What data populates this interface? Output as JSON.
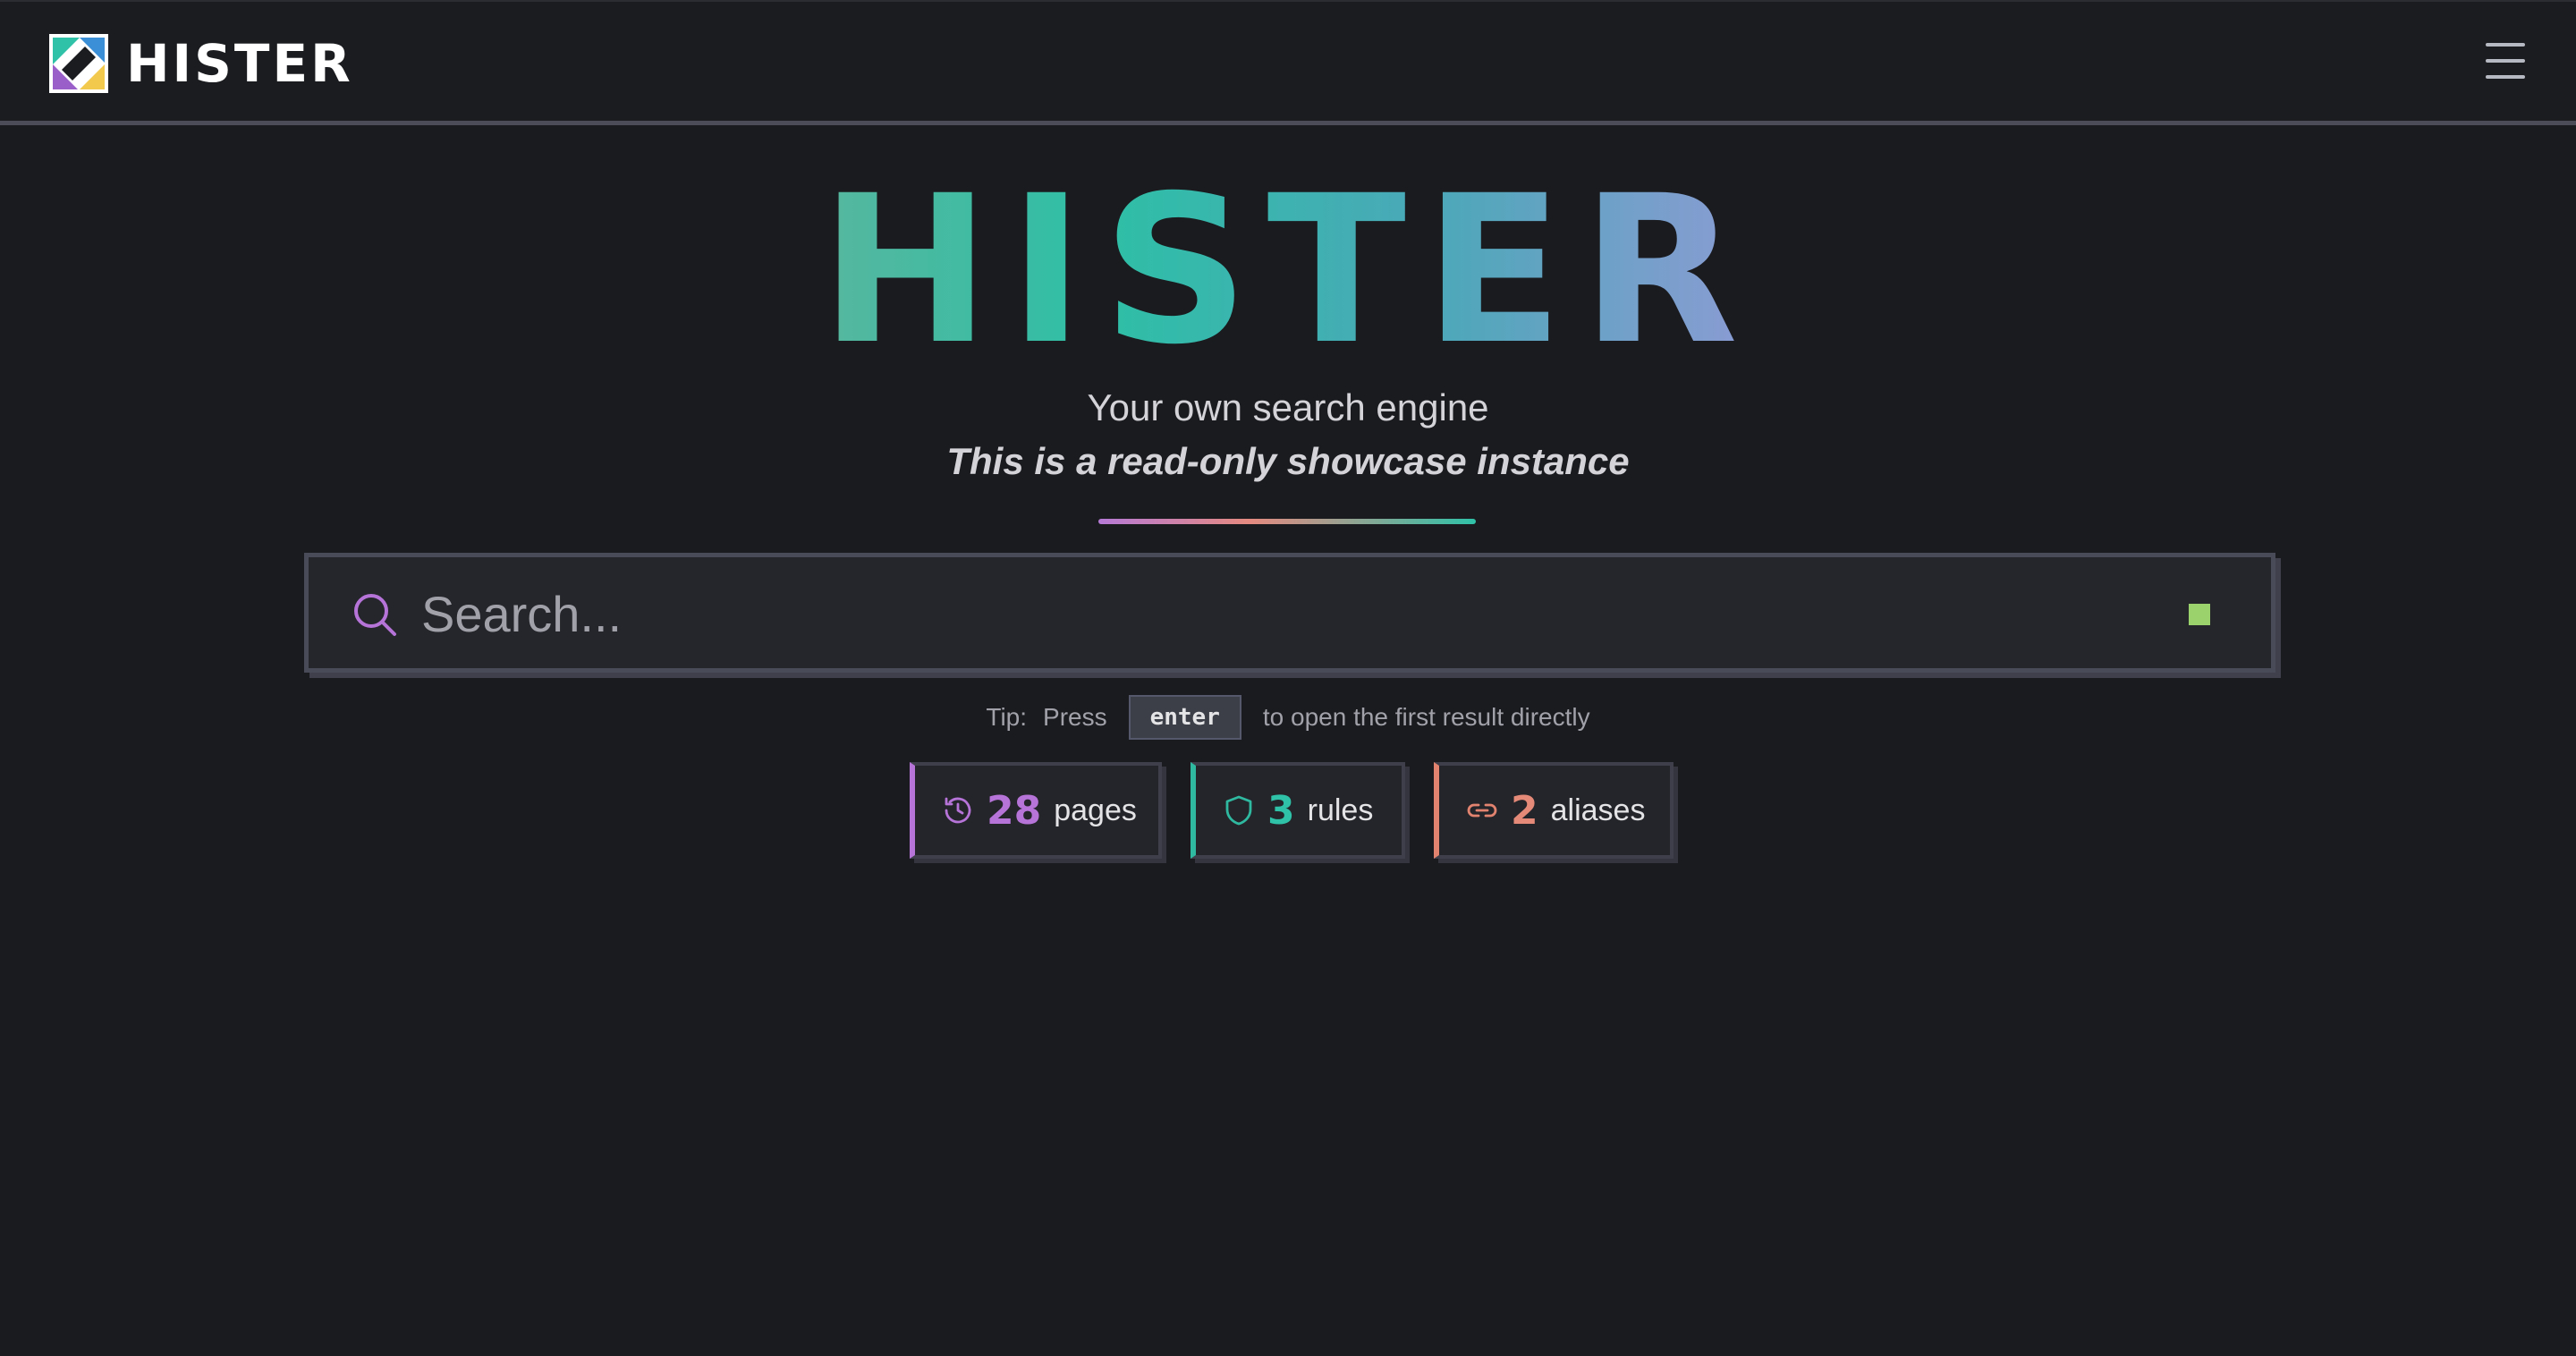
{
  "header": {
    "brand_name": "HISTER",
    "logo_icon": "hister-logo-icon",
    "menu_icon": "hamburger-menu-icon"
  },
  "hero": {
    "title": "HISTER",
    "tagline": "Your own search engine",
    "notice": "This is a read-only showcase instance"
  },
  "search": {
    "placeholder": "Search...",
    "value": "",
    "icon": "search-icon",
    "status_color": "#9bd26b"
  },
  "tip": {
    "prefix": "Tip:",
    "press": "Press",
    "key": "enter",
    "suffix": "to open the first result directly"
  },
  "stats": [
    {
      "icon": "history-icon",
      "value": "28",
      "label": "pages",
      "color": "#b673d8"
    },
    {
      "icon": "shield-icon",
      "value": "3",
      "label": "rules",
      "color": "#2fb9a1"
    },
    {
      "icon": "link-icon",
      "value": "2",
      "label": "aliases",
      "color": "#e2836f"
    }
  ],
  "colors": {
    "background": "#1a1b1e",
    "accent_purple": "#b673d8",
    "accent_teal": "#2fc2a8",
    "accent_coral": "#e58a78"
  }
}
